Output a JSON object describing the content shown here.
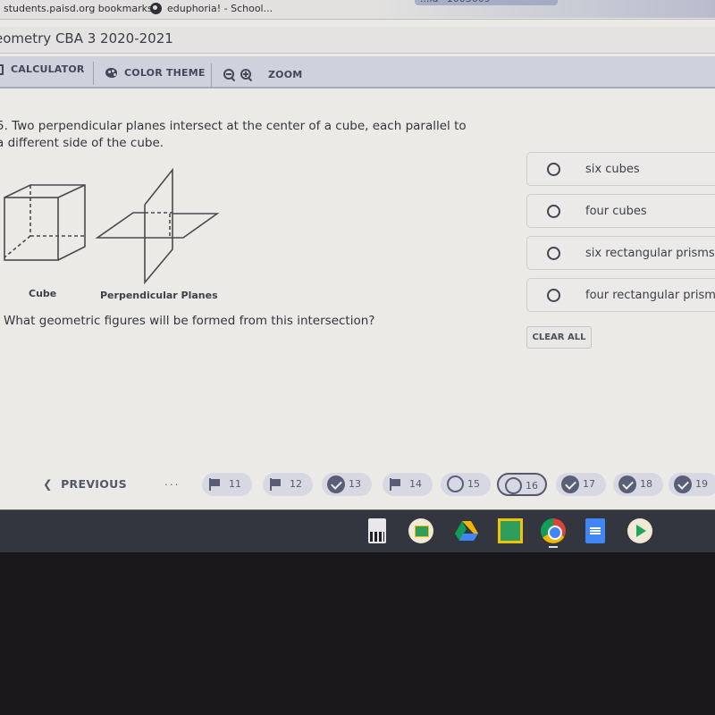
{
  "bookmarks_bar": {
    "items": [
      {
        "label": "students.paisd.org bookmarks",
        "icon": "none"
      },
      {
        "label": "eduphoria! - School...",
        "icon": "globe-icon"
      }
    ],
    "url_fragment": "...id=1003609"
  },
  "test": {
    "title": "eometry CBA 3 2020-2021"
  },
  "toolbar": {
    "calculator_label": "CALCULATOR",
    "color_theme_label": "COLOR THEME",
    "zoom_label": "ZOOM"
  },
  "question": {
    "number_fragment": "5.",
    "stem": "Two perpendicular planes intersect at the center of a cube, each parallel to a different side of the cube.",
    "prompt": "What geometric figures will be formed from this intersection?",
    "figure_labels": {
      "cube": "Cube",
      "planes": "Perpendicular Planes"
    },
    "choices": [
      {
        "label": "six cubes",
        "selected": false
      },
      {
        "label": "four cubes",
        "selected": false
      },
      {
        "label": "six rectangular prisms",
        "selected": false
      },
      {
        "label": "four rectangular prisms",
        "selected": false
      }
    ],
    "clear_all_label": "CLEAR ALL"
  },
  "navigation": {
    "previous_label": "PREVIOUS",
    "ellipsis": "...",
    "items": [
      {
        "number": "11",
        "status": "flagged"
      },
      {
        "number": "12",
        "status": "flagged"
      },
      {
        "number": "13",
        "status": "answered"
      },
      {
        "number": "14",
        "status": "flagged"
      },
      {
        "number": "15",
        "status": "unanswered"
      },
      {
        "number": "16",
        "status": "current-unanswered"
      },
      {
        "number": "17",
        "status": "answered"
      },
      {
        "number": "18",
        "status": "answered"
      },
      {
        "number": "19",
        "status": "answered"
      }
    ]
  },
  "shelf": {
    "apps": [
      "calculator-app-icon",
      "google-classroom-icon",
      "google-drive-icon",
      "classroom-teacher-icon",
      "chrome-icon",
      "google-docs-icon",
      "play-store-icon"
    ]
  }
}
